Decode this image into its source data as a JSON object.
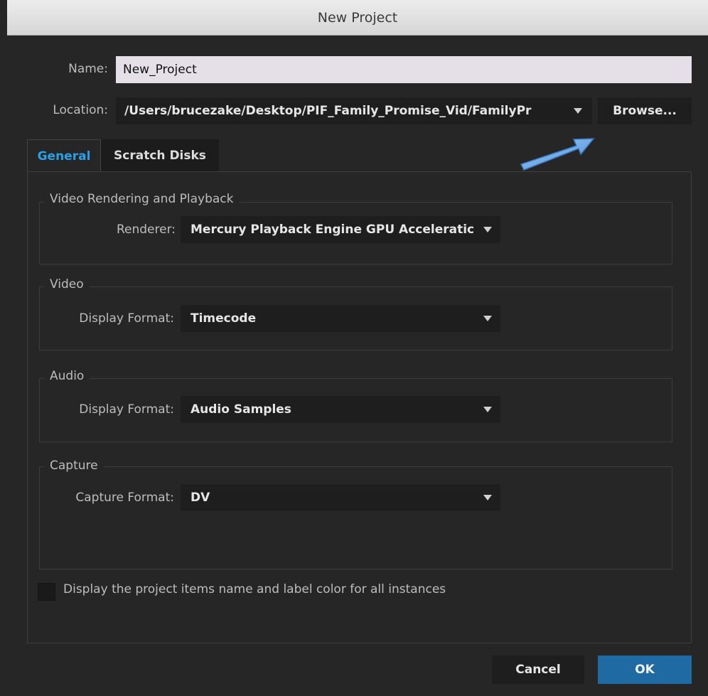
{
  "window": {
    "title": "New Project"
  },
  "name": {
    "label": "Name:",
    "value": "New_Project"
  },
  "location": {
    "label": "Location:",
    "value": "/Users/brucezake/Desktop/PIF_Family_Promise_Vid/FamilyPr",
    "browse_label": "Browse..."
  },
  "tabs": [
    {
      "label": "General",
      "active": true
    },
    {
      "label": "Scratch Disks",
      "active": false
    }
  ],
  "groups": {
    "video_rendering": {
      "title": "Video Rendering and Playback",
      "renderer_label": "Renderer:",
      "renderer_value": "Mercury Playback Engine GPU Acceleratic"
    },
    "video": {
      "title": "Video",
      "format_label": "Display Format:",
      "format_value": "Timecode"
    },
    "audio": {
      "title": "Audio",
      "format_label": "Display Format:",
      "format_value": "Audio Samples"
    },
    "capture": {
      "title": "Capture",
      "format_label": "Capture Format:",
      "format_value": "DV"
    }
  },
  "checkbox": {
    "label": "Display the project items name and label color for all instances",
    "checked": false
  },
  "buttons": {
    "cancel": "Cancel",
    "ok": "OK"
  },
  "colors": {
    "accent_tab": "#2aa0e6",
    "ok_button": "#1f6aa3",
    "annotation_arrow": "#6aa8e8"
  },
  "icons": {
    "dropdown": "chevron-down-icon",
    "annotation": "arrow-pointer-icon"
  }
}
